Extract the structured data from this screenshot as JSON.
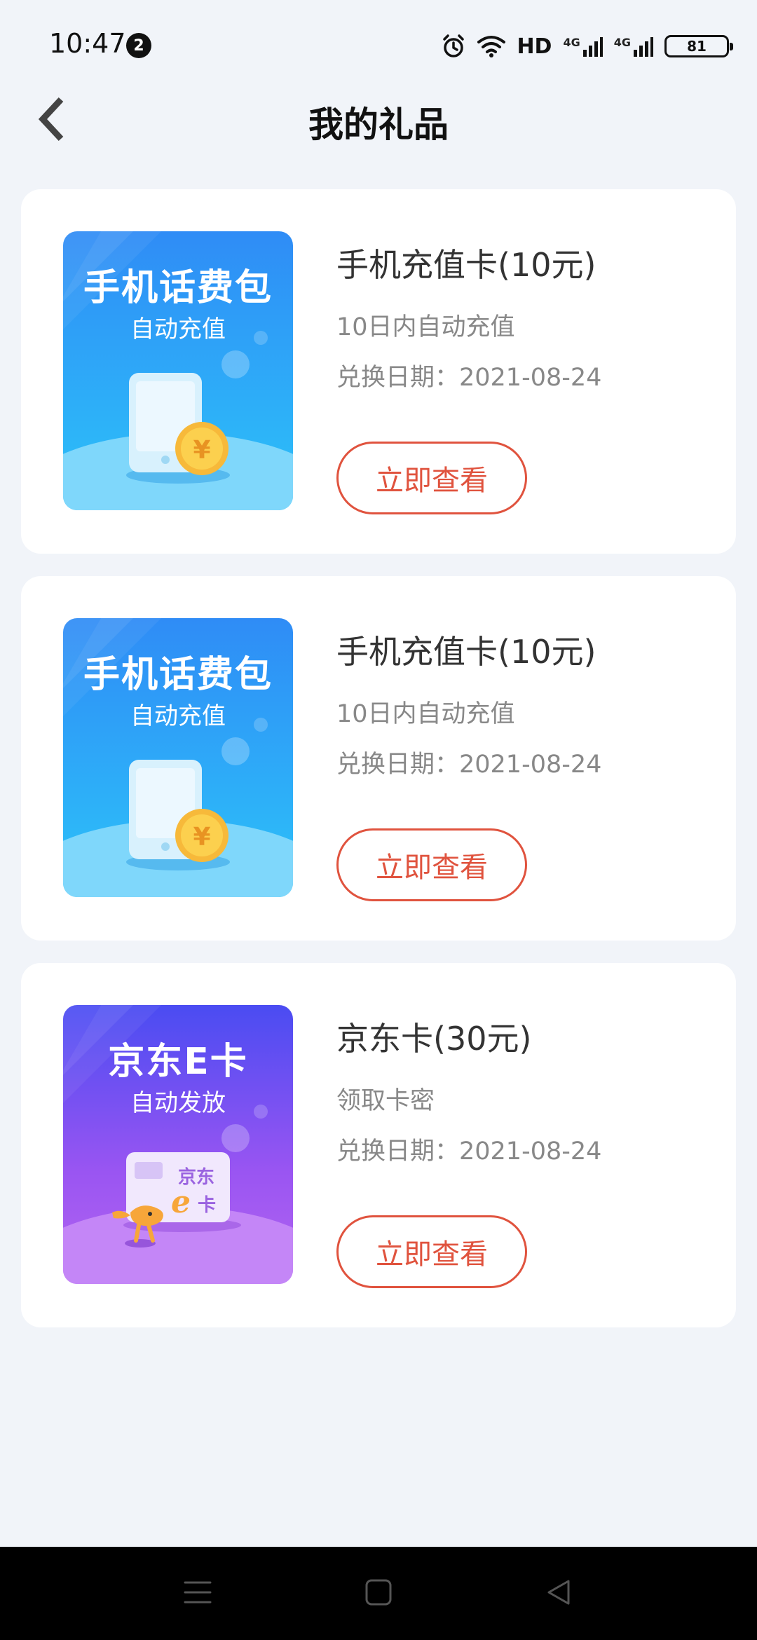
{
  "status_bar": {
    "time": "10:47",
    "notification_count": "2",
    "network_hd": "HD",
    "network_4g_1": "4G",
    "network_4g_2": "4G",
    "battery_level": "81"
  },
  "header": {
    "title": "我的礼品",
    "back_icon": "chevron-left-icon"
  },
  "gifts": [
    {
      "thumb_title": "手机话费包",
      "thumb_subtitle": "自动充值",
      "name": "手机充值卡(10元)",
      "desc": "10日内自动充值",
      "date": "兑换日期：2021-08-24",
      "button_label": "立即查看",
      "theme": "blue"
    },
    {
      "thumb_title": "手机话费包",
      "thumb_subtitle": "自动充值",
      "name": "手机充值卡(10元)",
      "desc": "10日内自动充值",
      "date": "兑换日期：2021-08-24",
      "button_label": "立即查看",
      "theme": "blue"
    },
    {
      "thumb_title": "京东E卡",
      "thumb_subtitle": "自动发放",
      "name": "京东卡(30元)",
      "desc": "领取卡密",
      "date": "兑换日期：2021-08-24",
      "button_label": "立即查看",
      "theme": "purple",
      "card_brand": "京东",
      "card_e": "e",
      "card_ka": "卡"
    }
  ],
  "colors": {
    "background": "#f1f4f9",
    "accent": "#e0533e",
    "blue_top": "#2f8cf6",
    "purple_top": "#4a4cf2"
  },
  "nav": {
    "menu_icon": "menu-icon",
    "home_icon": "home-square-icon",
    "back_icon": "back-triangle-icon"
  }
}
